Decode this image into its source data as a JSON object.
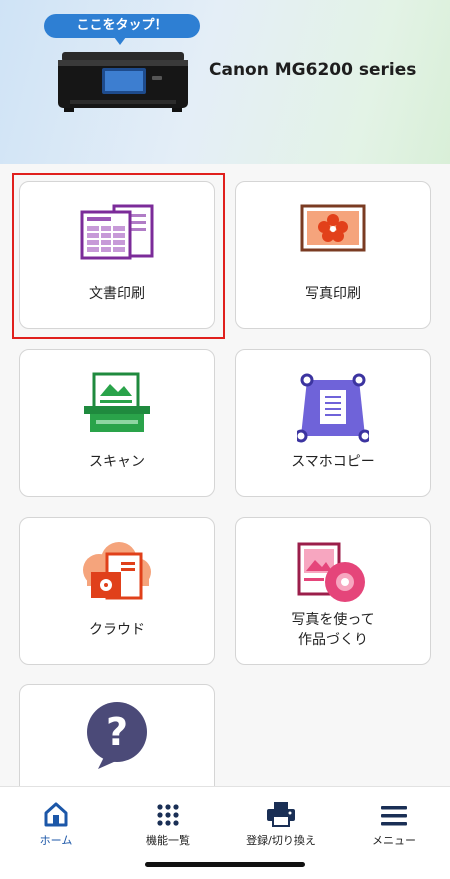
{
  "header": {
    "tap_hint": "ここをタップ！",
    "printer_name": "Canon MG6200 series"
  },
  "menu": {
    "document_print": "文書印刷",
    "photo_print": "写真印刷",
    "scan": "スキャン",
    "smartphone_copy": "スマホコピー",
    "cloud": "クラウド",
    "photo_creative": "写真を使って\n作品づくり"
  },
  "bottom_nav": {
    "home": "ホーム",
    "functions": "機能一覧",
    "register": "登録/切り換え",
    "menu": "メニュー"
  },
  "colors": {
    "accent": "#1c57a8",
    "highlight": "#e0201d",
    "tap_bubble": "#2e7fd3"
  }
}
